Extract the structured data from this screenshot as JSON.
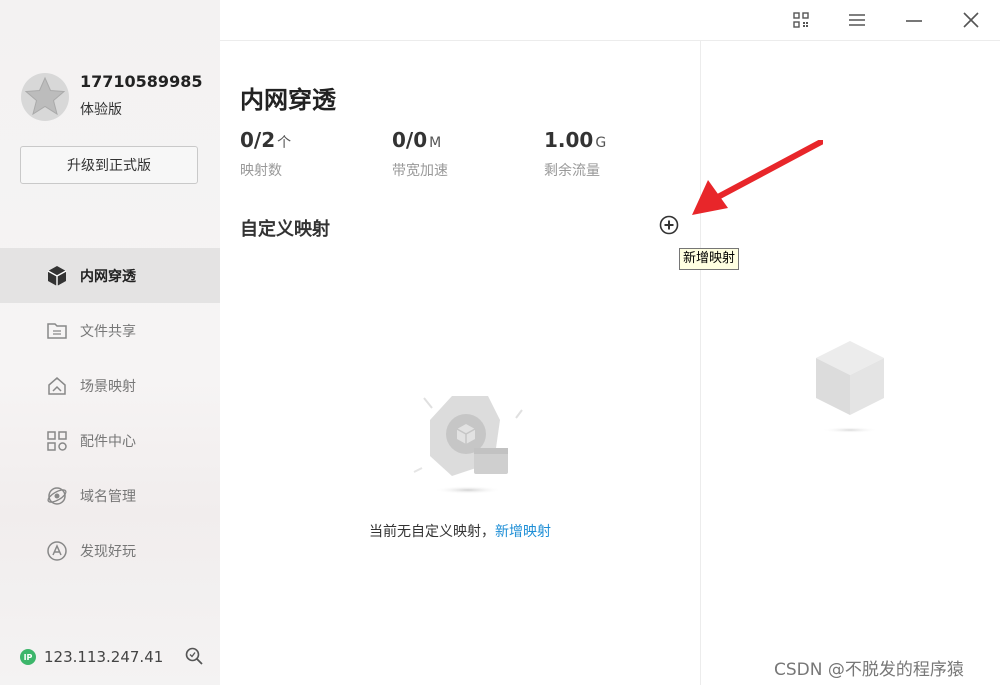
{
  "user": {
    "id": "17710589985",
    "plan": "体验版",
    "upgrade_label": "升级到正式版"
  },
  "nav": {
    "items": [
      {
        "label": "内网穿透",
        "icon": "cube-icon",
        "active": true
      },
      {
        "label": "文件共享",
        "icon": "folder-icon",
        "active": false
      },
      {
        "label": "场景映射",
        "icon": "house-icon",
        "active": false
      },
      {
        "label": "配件中心",
        "icon": "grid-icon",
        "active": false
      },
      {
        "label": "域名管理",
        "icon": "globe-icon",
        "active": false
      },
      {
        "label": "发现好玩",
        "icon": "compass-icon",
        "active": false
      }
    ]
  },
  "status": {
    "ip_badge": "IP",
    "ip": "123.113.247.41"
  },
  "main": {
    "title": "内网穿透",
    "stats": [
      {
        "value": "0/2",
        "unit": "个",
        "label": "映射数"
      },
      {
        "value": "0/0",
        "unit": "M",
        "label": "带宽加速"
      },
      {
        "value": "1.00",
        "unit": "G",
        "label": "剩余流量"
      }
    ],
    "section_title": "自定义映射",
    "tooltip": "新增映射",
    "empty_text": "当前无自定义映射，",
    "empty_link": "新增映射"
  },
  "watermark": "CSDN @不脱发的程序猿",
  "colors": {
    "accent": "#1d8ed6",
    "ip_green": "#3db66b",
    "arrow": "#e8262a"
  }
}
